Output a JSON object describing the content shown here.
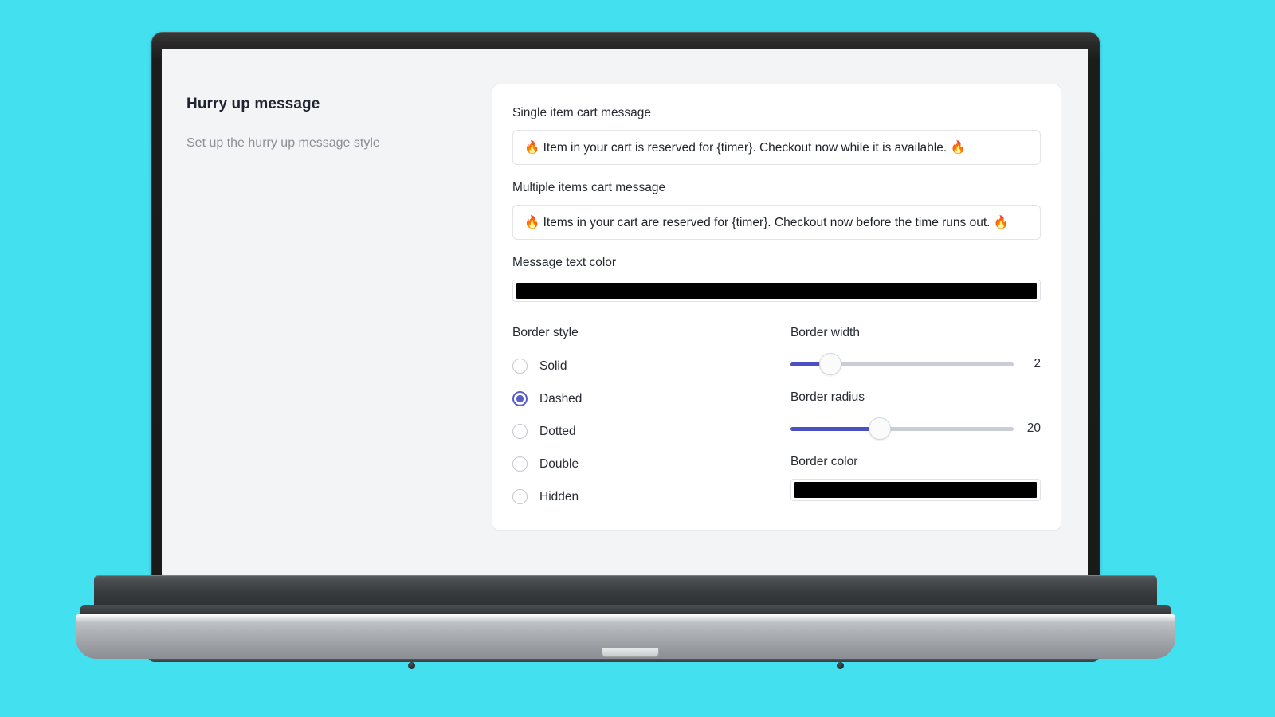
{
  "device": {
    "type": "laptop-mockup"
  },
  "background_color": "#43e0f0",
  "accent_color": "#5a5fc4",
  "slider_fill_color": "#4b51c0",
  "sidebar": {
    "heading": "Hurry up message",
    "description": "Set up the hurry up message style"
  },
  "form": {
    "single_item": {
      "label": "Single item cart message",
      "value": "🔥 Item in your cart is reserved for {timer}. Checkout now while it is available. 🔥",
      "placeholder": "Single item cart message"
    },
    "multiple_items": {
      "label": "Multiple items cart message",
      "value": "🔥 Items in your cart are reserved for {timer}. Checkout now before the time runs out. 🔥",
      "placeholder": "Multiple items cart message"
    },
    "message_text_color": {
      "label": "Message text color",
      "value": "#000000"
    },
    "border_style": {
      "label": "Border style",
      "selected": "Dashed",
      "options": [
        {
          "label": "Solid",
          "selected": false
        },
        {
          "label": "Dashed",
          "selected": true
        },
        {
          "label": "Dotted",
          "selected": false
        },
        {
          "label": "Double",
          "selected": false
        },
        {
          "label": "Hidden",
          "selected": false
        }
      ]
    },
    "border_width": {
      "label": "Border width",
      "value": "2",
      "percent": 18
    },
    "border_radius": {
      "label": "Border radius",
      "value": "20",
      "percent": 40
    },
    "border_color": {
      "label": "Border color",
      "value": "#000000"
    }
  }
}
